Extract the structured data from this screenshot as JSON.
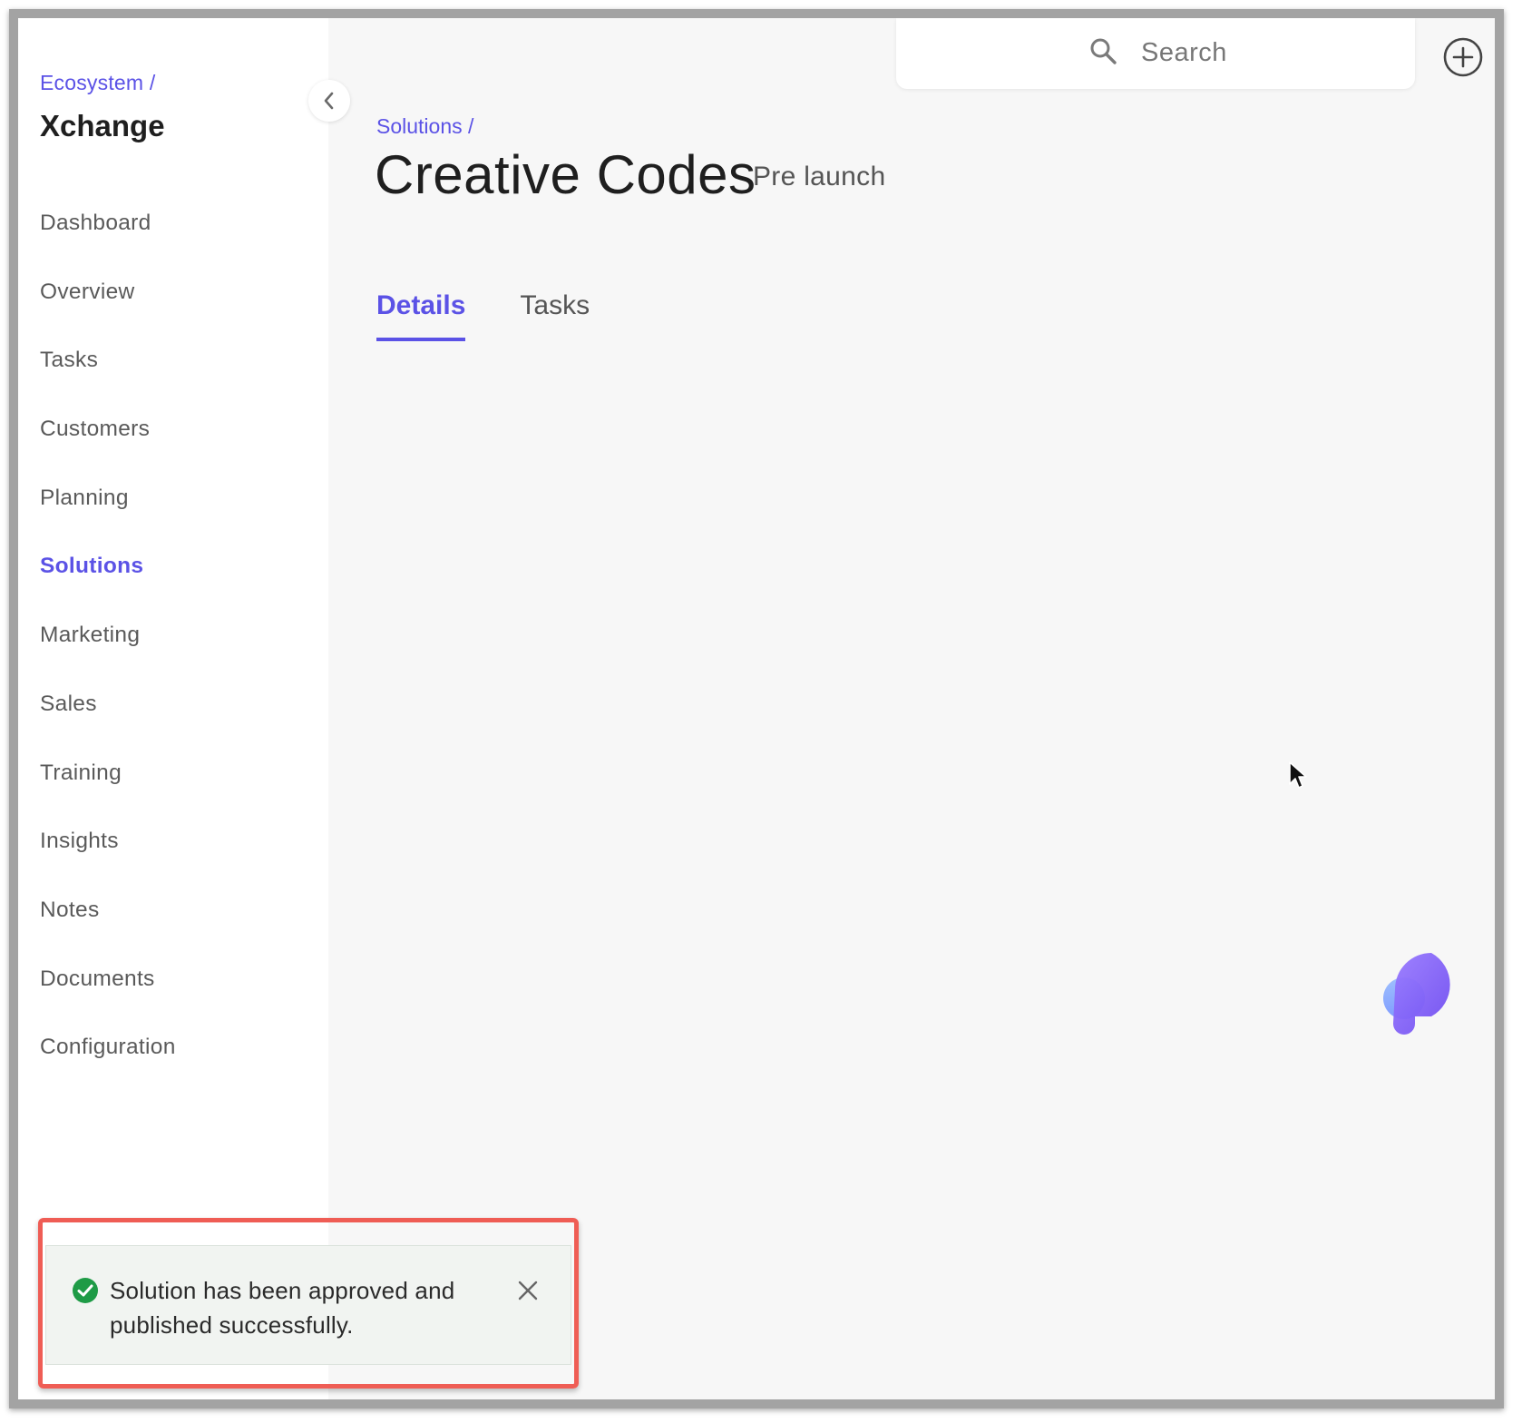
{
  "sidebar": {
    "breadcrumb": "Ecosystem /",
    "app_title": "Xchange",
    "items": [
      {
        "label": "Dashboard"
      },
      {
        "label": "Overview"
      },
      {
        "label": "Tasks"
      },
      {
        "label": "Customers"
      },
      {
        "label": "Planning"
      },
      {
        "label": "Solutions",
        "active": true
      },
      {
        "label": "Marketing"
      },
      {
        "label": "Sales"
      },
      {
        "label": "Training"
      },
      {
        "label": "Insights"
      },
      {
        "label": "Notes"
      },
      {
        "label": "Documents"
      },
      {
        "label": "Configuration"
      }
    ]
  },
  "header": {
    "search_placeholder": "Search"
  },
  "page": {
    "breadcrumb": "Solutions /",
    "title": "Creative Codes",
    "status": "Pre launch",
    "tabs": [
      {
        "label": "Details",
        "active": true
      },
      {
        "label": "Tasks",
        "active": false
      }
    ]
  },
  "toast": {
    "message": "Solution has been approved and published successfully.",
    "type": "success"
  },
  "colors": {
    "accent": "#5b52e6",
    "success": "#1e9b46",
    "highlight_border": "#ef5d55"
  },
  "icons": {
    "collapse": "chevron-left-icon",
    "search": "search-icon",
    "add": "plus-circle-icon",
    "toast_status": "check-circle-icon",
    "toast_close": "close-icon"
  }
}
